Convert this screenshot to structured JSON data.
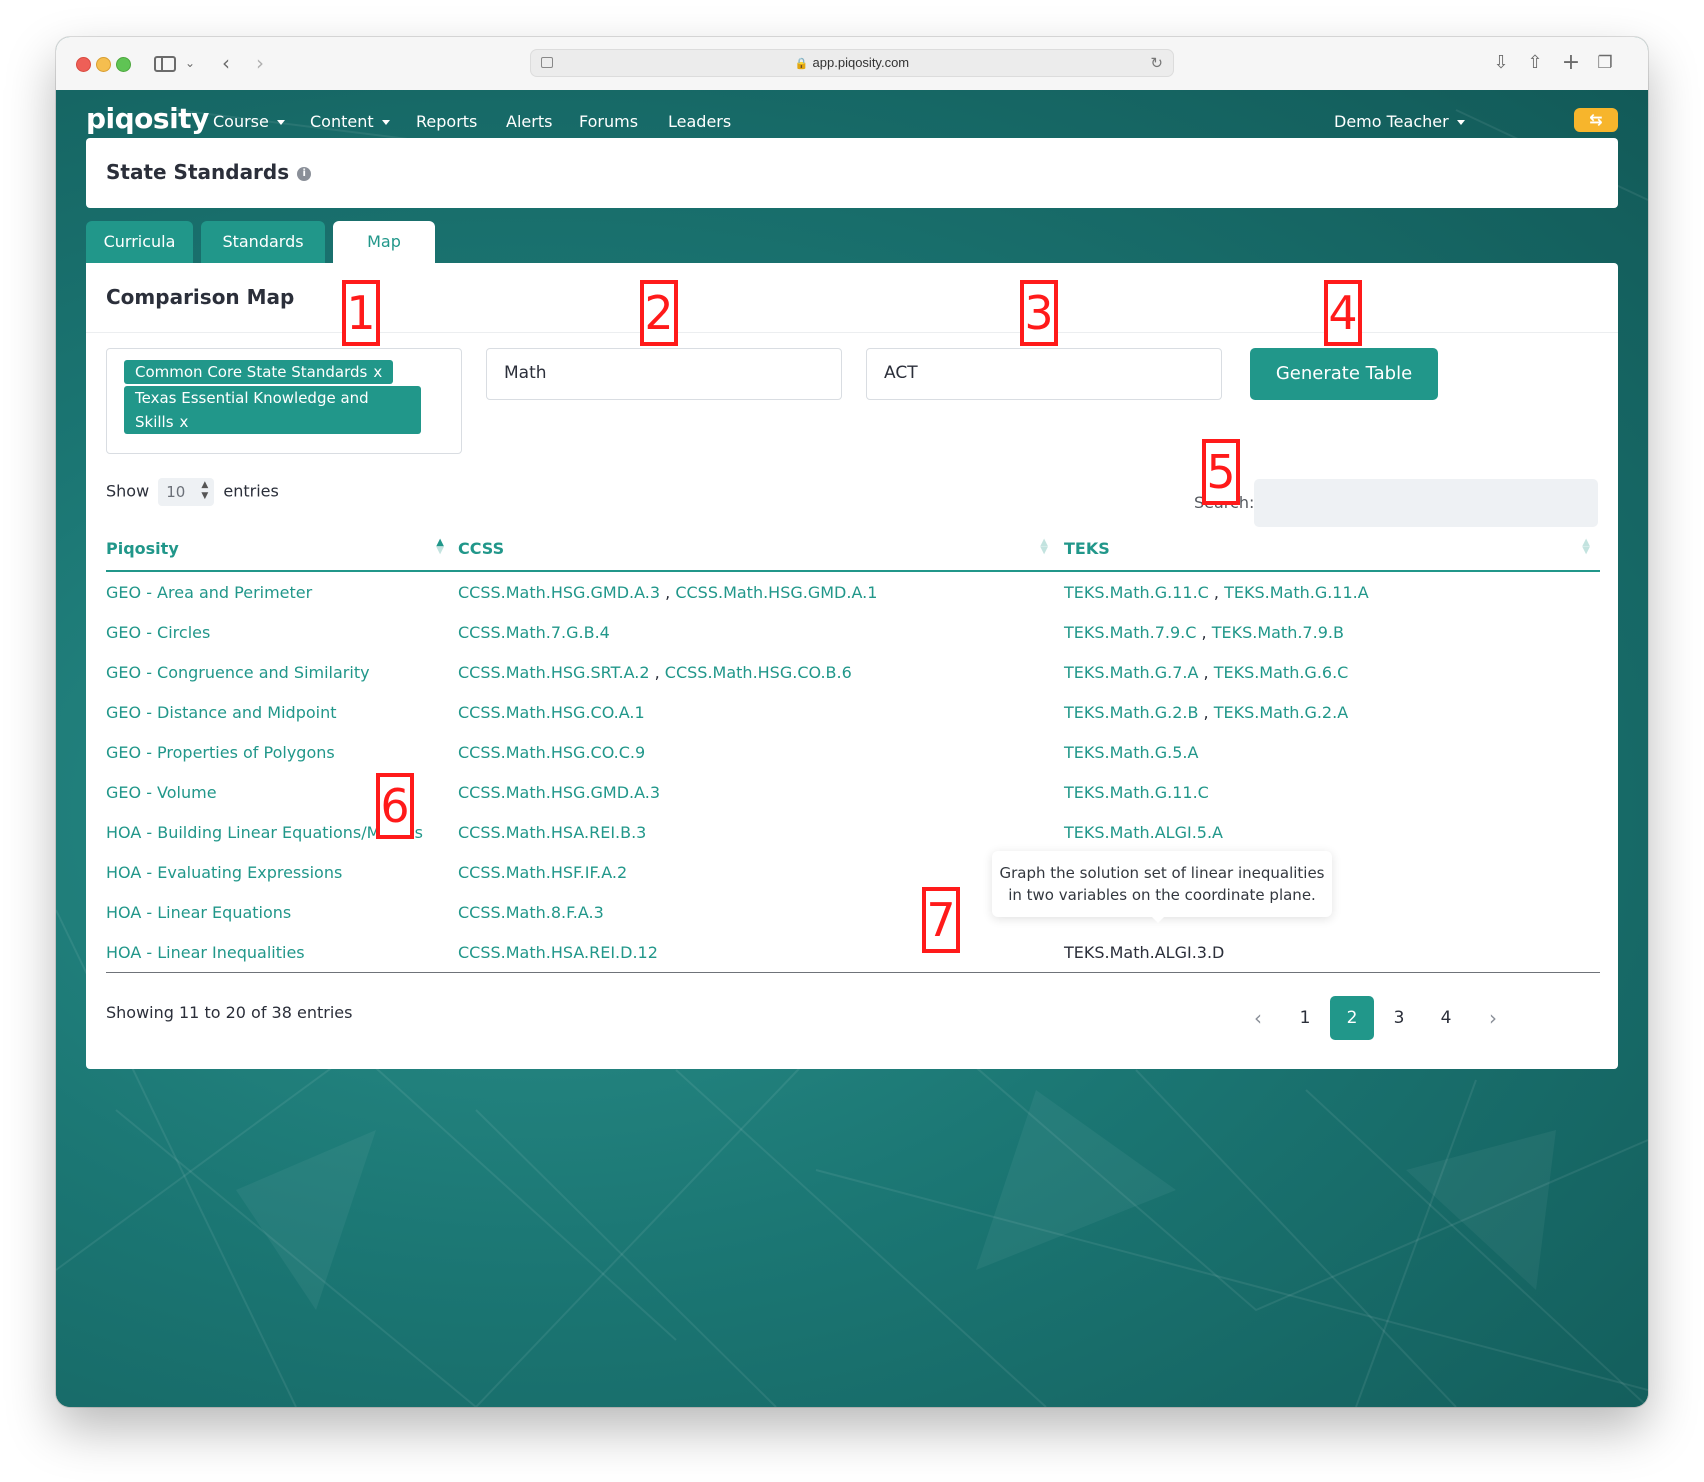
{
  "browser": {
    "url": "app.piqosity.com"
  },
  "nav": {
    "logo": "piqosity",
    "items": [
      "Course",
      "Content",
      "Reports",
      "Alerts",
      "Forums",
      "Leaders"
    ],
    "user": "Demo Teacher"
  },
  "header": {
    "title": "State Standards"
  },
  "tabs": [
    "Curricula",
    "Standards",
    "Map"
  ],
  "comparison": {
    "title": "Comparison Map",
    "selected_standards": [
      "Common Core State Standards",
      "Texas Essential Knowledge and",
      "Skills"
    ],
    "tag_remove": "x",
    "subject": "Math",
    "test": "ACT",
    "generate_label": "Generate Table",
    "show_label": "Show",
    "entries_value": "10",
    "entries_label": "entries",
    "search_label": "Search:"
  },
  "table": {
    "headers": [
      "Piqosity",
      "CCSS",
      "TEKS"
    ],
    "rows": [
      {
        "piq": "GEO - Area and Perimeter",
        "ccss": [
          "CCSS.Math.HSG.GMD.A.3",
          "CCSS.Math.HSG.GMD.A.1"
        ],
        "teks": [
          "TEKS.Math.G.11.C",
          "TEKS.Math.G.11.A"
        ]
      },
      {
        "piq": "GEO - Circles",
        "ccss": [
          "CCSS.Math.7.G.B.4"
        ],
        "teks": [
          "TEKS.Math.7.9.C",
          "TEKS.Math.7.9.B"
        ]
      },
      {
        "piq": "GEO - Congruence and Similarity",
        "ccss": [
          "CCSS.Math.HSG.SRT.A.2",
          "CCSS.Math.HSG.CO.B.6"
        ],
        "teks": [
          "TEKS.Math.G.7.A",
          "TEKS.Math.G.6.C"
        ]
      },
      {
        "piq": "GEO - Distance and Midpoint",
        "ccss": [
          "CCSS.Math.HSG.CO.A.1"
        ],
        "teks": [
          "TEKS.Math.G.2.B",
          "TEKS.Math.G.2.A"
        ]
      },
      {
        "piq": "GEO - Properties of Polygons",
        "ccss": [
          "CCSS.Math.HSG.CO.C.9"
        ],
        "teks": [
          "TEKS.Math.G.5.A"
        ]
      },
      {
        "piq": "GEO - Volume",
        "ccss": [
          "CCSS.Math.HSG.GMD.A.3"
        ],
        "teks": [
          "TEKS.Math.G.11.C"
        ]
      },
      {
        "piq": "HOA - Building Linear Equations/Models",
        "ccss": [
          "CCSS.Math.HSA.REI.B.3"
        ],
        "teks": [
          "TEKS.Math.ALGI.5.A"
        ]
      },
      {
        "piq": "HOA - Evaluating Expressions",
        "ccss": [
          "CCSS.Math.HSF.IF.A.2"
        ],
        "teks": []
      },
      {
        "piq": "HOA - Linear Equations",
        "ccss": [
          "CCSS.Math.8.F.A.3"
        ],
        "teks": []
      },
      {
        "piq": "HOA - Linear Inequalities",
        "ccss": [
          "CCSS.Math.HSA.REI.D.12"
        ],
        "teks": [
          "TEKS.Math.ALGI.3.D"
        ]
      }
    ]
  },
  "info": "Showing 11 to 20 of 38 entries",
  "pagination": {
    "pages": [
      "1",
      "2",
      "3",
      "4"
    ],
    "current": "2"
  },
  "tooltip": {
    "line1": "Graph the solution set of linear inequalities",
    "line2": "in two variables on the coordinate plane."
  },
  "annotations": [
    "1",
    "2",
    "3",
    "4",
    "5",
    "6",
    "7"
  ],
  "colors": {
    "accent": "#21978a",
    "annotation": "#ff1a1a",
    "sync_button": "#f7b52c"
  }
}
